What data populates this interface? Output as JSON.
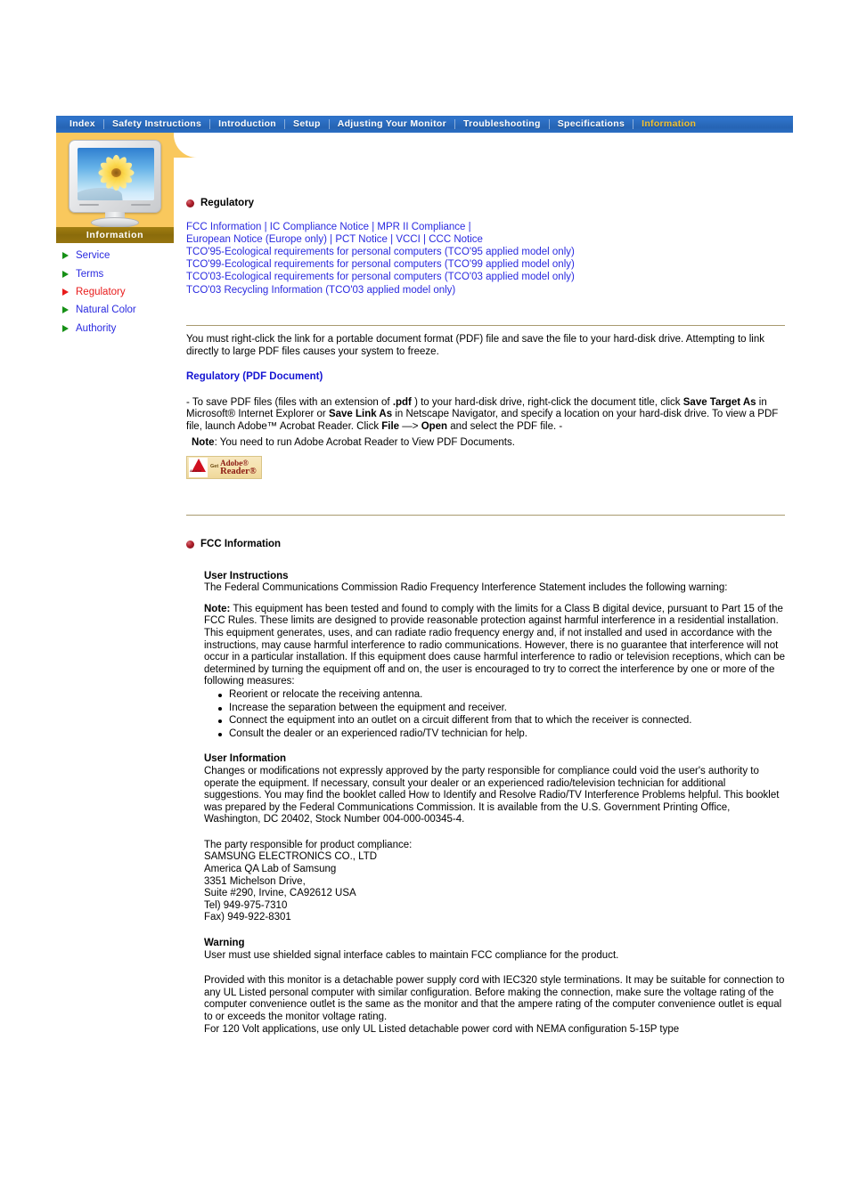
{
  "nav": {
    "items": [
      {
        "label": "Index",
        "active": false
      },
      {
        "label": "Safety Instructions",
        "active": false
      },
      {
        "label": "Introduction",
        "active": false
      },
      {
        "label": "Setup",
        "active": false
      },
      {
        "label": "Adjusting Your Monitor",
        "active": false
      },
      {
        "label": "Troubleshooting",
        "active": false
      },
      {
        "label": "Specifications",
        "active": false
      },
      {
        "label": "Information",
        "active": true
      }
    ],
    "active_color": "#f2c131",
    "bar_color": "#2a6bbd"
  },
  "sidebar": {
    "panel_color": "#f9c85d",
    "caption": "Information",
    "caption_bar_color": "#8a6b0b",
    "items": [
      {
        "label": "Service",
        "active": false
      },
      {
        "label": "Terms",
        "active": false
      },
      {
        "label": "Regulatory",
        "active": true
      },
      {
        "label": "Natural Color",
        "active": false
      },
      {
        "label": "Authority",
        "active": false
      }
    ],
    "link_color": "#2a2ae0",
    "active_color": "#e81b1b",
    "arrow_color": "#169016"
  },
  "main": {
    "regulatory": {
      "heading": "Regulatory",
      "links_line1": [
        "FCC Information",
        "IC Compliance Notice",
        "MPR II Compliance"
      ],
      "links_line2": [
        "European Notice (Europe only)",
        "PCT Notice",
        "VCCI",
        "CCC Notice"
      ],
      "links_rest": [
        "TCO'95-Ecological requirements for personal computers (TCO'95 applied model only)",
        "TCO'99-Ecological requirements for personal computers (TCO'99 applied model only)",
        "TCO'03-Ecological requirements for personal computers (TCO'03 applied model only)",
        "TCO'03 Recycling Information (TCO'03 applied model only)"
      ],
      "separator": "|",
      "intro_p1": "You must right-click the link for a portable document format (PDF) file and save the file to your hard-disk drive. Attempting to link directly to large PDF files causes your system to freeze.",
      "pdf_doc_heading": "Regulatory (PDF Document)",
      "pdf_instructions": {
        "t1": "- To save PDF files (files with an extension of ",
        "b1": ".pdf",
        "t2": " ) to your hard-disk drive, right-click the document title, click ",
        "b2": "Save Target As",
        "t3": " in Microsoft® Internet Explorer or ",
        "b3": "Save Link As",
        "t4": " in Netscape Navigator, and specify a location on your hard-disk drive. To view a PDF file, launch Adobe™ Acrobat Reader. Click ",
        "b4": "File",
        "t5": " —> ",
        "b5": "Open",
        "t6": " and select the PDF file. -"
      },
      "note_label": "Note",
      "note_text": ": You need to run Adobe Acrobat Reader to View PDF Documents.",
      "adobe_badge": {
        "get": "Get",
        "line1": "Adobe®",
        "line2": "Reader®",
        "mark": "Adobe"
      }
    },
    "fcc": {
      "heading": "FCC Information",
      "user_instructions_heading": "User Instructions",
      "user_instructions_text": "The Federal Communications Commission Radio Frequency Interference Statement includes the following warning:",
      "note_label": "Note:",
      "note_body": " This equipment has been tested and found to comply with the limits for a Class B digital device, pursuant to Part 15 of the FCC Rules. These limits are designed to provide reasonable protection against harmful interference in a residential installation. This equipment generates, uses, and can radiate radio frequency energy and, if not installed and used in accordance with the instructions, may cause harmful interference to radio communications. However, there is no guarantee that interference will not occur in a particular installation. If this equipment does cause harmful interference to radio or television receptions, which can be determined by turning the equipment off and on, the user is encouraged to try to correct the interference by one or more of the following measures:",
      "measures": [
        "Reorient or relocate the receiving antenna.",
        "Increase the separation between the equipment and receiver.",
        "Connect the equipment into an outlet on a circuit different from that to which the receiver is connected.",
        "Consult the dealer or an experienced radio/TV technician for help."
      ],
      "user_information_heading": "User Information",
      "user_information_text": "Changes or modifications not expressly approved by the party responsible for compliance could void the user's authority to operate the equipment. If necessary, consult your dealer or an experienced radio/television technician for additional suggestions. You may find the booklet called How to Identify and Resolve Radio/TV Interference Problems helpful. This booklet was prepared by the Federal Communications Commission. It is available from the U.S. Government Printing Office, Washington, DC 20402, Stock Number 004-000-00345-4.",
      "party_lines": [
        "The party responsible for product compliance:",
        "SAMSUNG ELECTRONICS CO., LTD",
        "America QA Lab of Samsung",
        "3351 Michelson Drive,",
        "Suite #290, Irvine, CA92612 USA",
        "Tel) 949-975-7310",
        "Fax) 949-922-8301"
      ],
      "warning_heading": "Warning",
      "warning_text": "User must use shielded signal interface cables to maintain FCC compliance for the product.",
      "power_cord_text": "Provided with this monitor is a detachable power supply cord with IEC320 style terminations. It may be suitable for connection to any UL Listed personal computer with similar configuration. Before making the connection, make sure the voltage rating of the computer convenience outlet is the same as the monitor and that the ampere rating of the computer convenience outlet is equal to or exceeds the monitor voltage rating.",
      "power_cord_text2": "For 120 Volt applications, use only UL Listed detachable power cord with NEMA configuration 5-15P type"
    }
  }
}
